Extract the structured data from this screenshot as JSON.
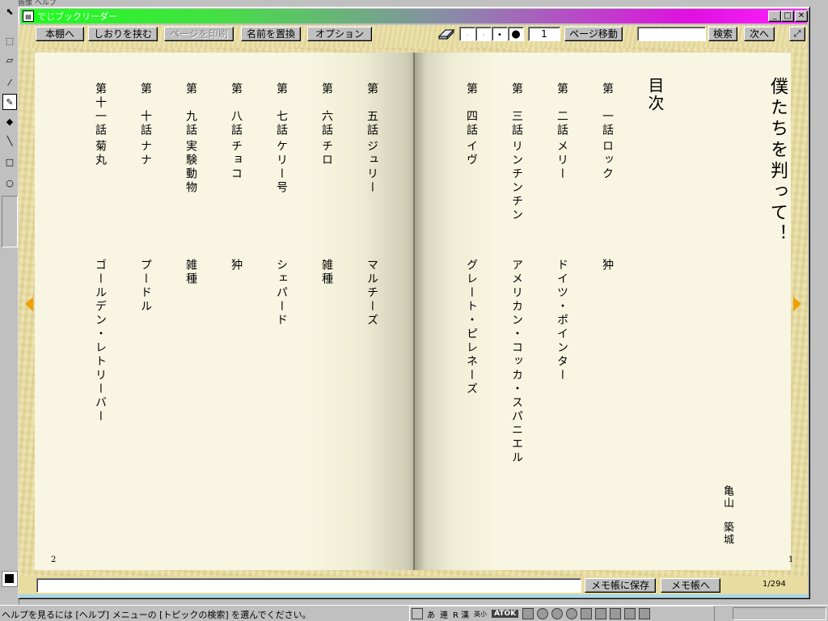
{
  "background_app": {
    "menu_fragment": "画像  ヘルプ",
    "tools": [
      "arrow-tool",
      "select-tool",
      "eraser-tool",
      "dropper-tool",
      "pencil-tool",
      "brush-tool",
      "line-tool",
      "rect-tool",
      "ellipse-tool"
    ]
  },
  "window": {
    "title": "でじブックリーダー",
    "controls": {
      "minimize": "_",
      "maximize": "□",
      "close": "✕"
    }
  },
  "toolbar": {
    "bookshelf": "本棚へ",
    "bookmark": "しおりを挟む",
    "print": "ページを印刷",
    "replace_name": "名前を置換",
    "options": "オプション",
    "page_value": "1",
    "page_jump": "ページ移動",
    "search_value": "",
    "search": "検索",
    "next": "次へ"
  },
  "book": {
    "right_page": {
      "title": "僕たちを判って！",
      "toc_heading": "目次",
      "author": "亀山　築城",
      "page_number": "1"
    },
    "left_page": {
      "page_number": "2"
    },
    "chapters": [
      {
        "num": "第　一話",
        "name": "ロック",
        "breed": "狆"
      },
      {
        "num": "第　二話",
        "name": "メリー",
        "breed": "ドイツ・ポインター"
      },
      {
        "num": "第　三話",
        "name": "リンチンチン",
        "breed": "アメリカン・コッカ・スパニエル"
      },
      {
        "num": "第　四話",
        "name": "イヴ",
        "breed": "グレート・ピレネーズ"
      },
      {
        "num": "第　五話",
        "name": "ジュリー",
        "breed": "マルチーズ"
      },
      {
        "num": "第　六話",
        "name": "チロ",
        "breed": "雑種"
      },
      {
        "num": "第　七話",
        "name": "ケリー号",
        "breed": "シェパード"
      },
      {
        "num": "第　八話",
        "name": "チョコ",
        "breed": "狆"
      },
      {
        "num": "第　九話",
        "name": "実験動物",
        "breed": "雑種"
      },
      {
        "num": "第　十話",
        "name": "ナナ",
        "breed": "プードル"
      },
      {
        "num": "第十一話",
        "name": "菊丸",
        "breed": "ゴールデン・レトリーバー"
      }
    ]
  },
  "bottom": {
    "memo_value": "",
    "save_memo": "メモ帳に保存",
    "to_memo": "メモ帳へ",
    "page_indicator": "1/294"
  },
  "statusbar": {
    "text": "ヘルプを見るには [ヘルプ] メニューの [トピックの検索] を選んでください。",
    "ime": [
      "あ",
      "連",
      "R 漢",
      "英小",
      "ATOK"
    ]
  },
  "colors": {
    "title_gradient_start": "#1bff1b",
    "title_gradient_end": "#ff22ff",
    "paper": "#f8f6e2",
    "parchment": "#e8dca0",
    "nav_arrow": "#f0a000"
  }
}
